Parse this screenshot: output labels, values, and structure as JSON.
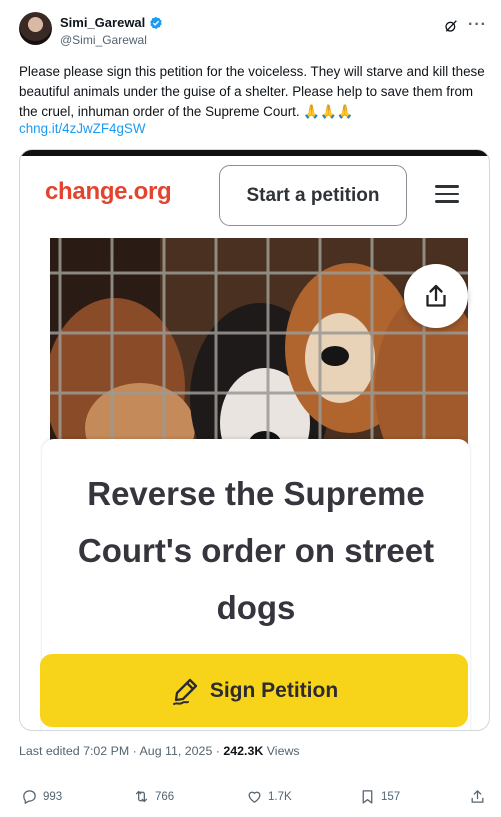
{
  "user": {
    "name": "Simi_Garewal",
    "handle": "@Simi_Garewal"
  },
  "tweet": {
    "text": "Please please sign this petition for the voiceless. They will starve and kill these beautiful animals under the guise of a shelter. Please help to save them from the cruel, inhuman order of the Supreme Court. 🙏🙏🙏",
    "link": "chng.it/4zJwZF4gSW"
  },
  "card": {
    "logo": "change.org",
    "start_label": "Start a petition",
    "photo_icon": "caged-dogs-image",
    "petition_title": "Reverse the Supreme Court's order on street dogs",
    "sign_label": "Sign Petition",
    "colors": {
      "logo": "#e2442f",
      "sign_button": "#f7d31a"
    }
  },
  "meta": {
    "edited": "Last edited 7:02 PM · Aug 11, 2025 · ",
    "views_count": "242.3K",
    "views_label": " Views"
  },
  "actions": {
    "replies": "993",
    "reposts": "766",
    "likes": "1.7K",
    "bookmarks": "157"
  }
}
